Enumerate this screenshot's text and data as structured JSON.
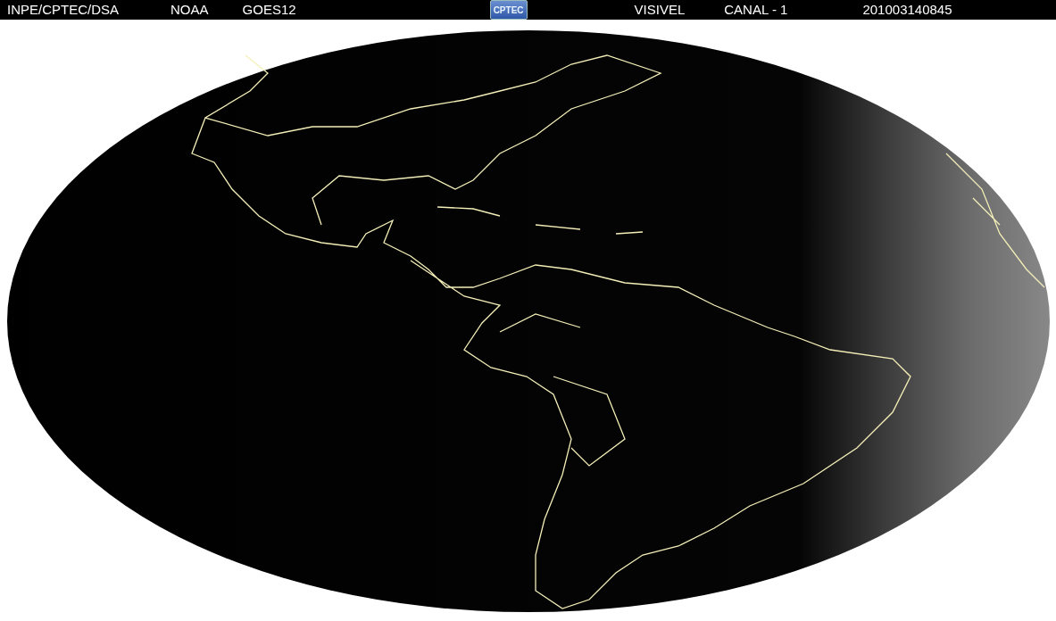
{
  "header": {
    "items": [
      {
        "kind": "text",
        "text": "INPE/CPTEC/DSA"
      },
      {
        "kind": "text",
        "text": "NOAA"
      },
      {
        "kind": "text",
        "text": "GOES12"
      },
      {
        "kind": "logo",
        "text": "CPTEC"
      },
      {
        "kind": "text",
        "text": "VISIVEL"
      },
      {
        "kind": "text",
        "text": "CANAL - 1"
      },
      {
        "kind": "text",
        "text": "201003140845"
      }
    ]
  }
}
